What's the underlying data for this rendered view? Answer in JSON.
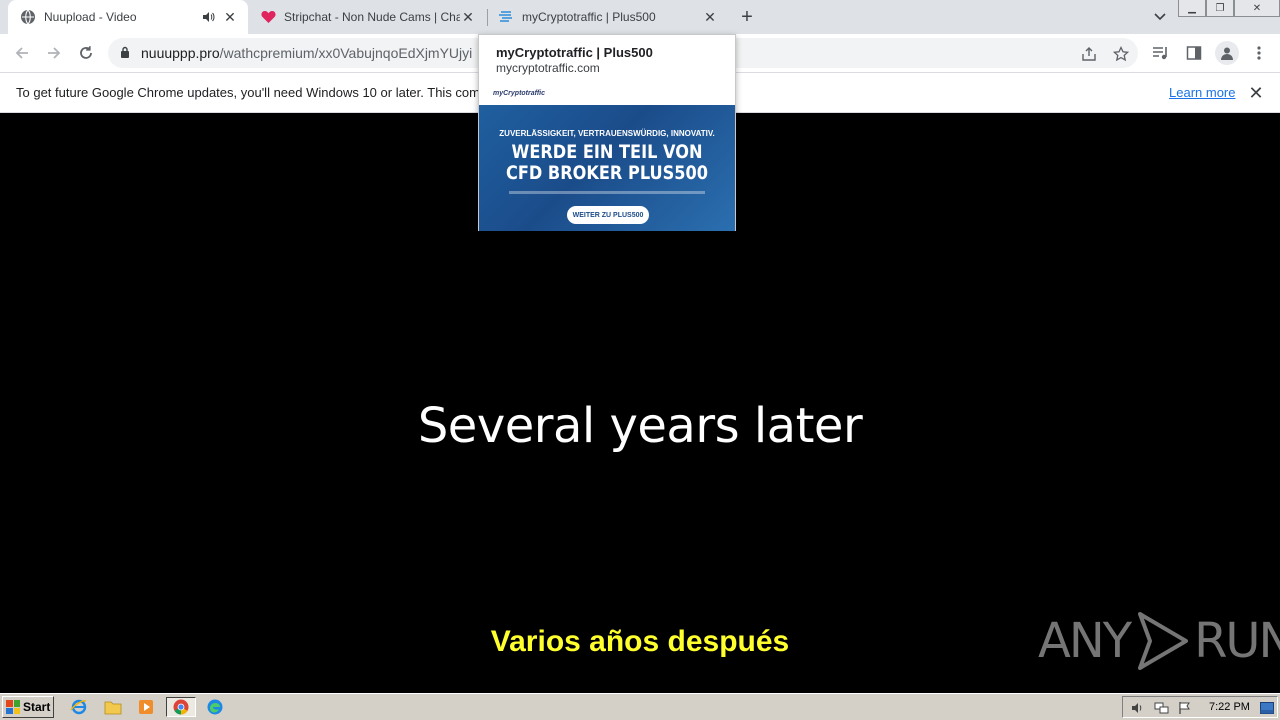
{
  "tabs": [
    {
      "title": "Nuupload - Video",
      "favicon": "globe-icon",
      "audio": true,
      "active": true
    },
    {
      "title": "Stripchat - Non Nude Cams | Chat wi",
      "favicon": "heart-icon",
      "active": false
    },
    {
      "title": "myCryptotraffic | Plus500",
      "favicon": "crypto-icon",
      "active": false
    }
  ],
  "toolbar": {
    "url_host": "nuuuppp.pro",
    "url_path": "/wathcpremium/xx0VabujnqoEdXjmYUjyi"
  },
  "infobar": {
    "message": "To get future Google Chrome updates, you'll need Windows 10 or later. This compu",
    "learn_more": "Learn more"
  },
  "hovercard": {
    "title": "myCryptotraffic | Plus500",
    "domain": "mycryptotraffic.com",
    "logo_text": "myCryptotraffic",
    "banner_tagline": "ZUVERLÄSSIGKEIT, VERTRAUENSWÜRDIG, INNOVATIV.",
    "banner_line1": "WERDE EIN TEIL VON",
    "banner_line2": "CFD BROKER PLUS500",
    "banner_cta": "WEITER ZU PLUS500"
  },
  "video": {
    "overlay_text": "Several years later",
    "subtitle": "Varios años después"
  },
  "watermark": {
    "left": "ANY",
    "right": "RUN"
  },
  "taskbar": {
    "start_label": "Start",
    "clock": "7:22 PM"
  },
  "colors": {
    "chrome_tabstrip": "#dee1e6",
    "subtitle_yellow": "#ffff2d",
    "link_blue": "#1a73e8"
  }
}
